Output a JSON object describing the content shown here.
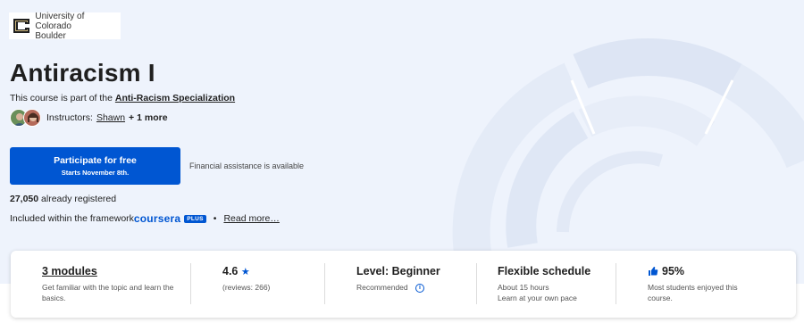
{
  "university": {
    "name_line1": "University of Colorado",
    "name_line2": "Boulder"
  },
  "course": {
    "title": "Antiracism I",
    "part_of_prefix": "This course is part of the",
    "specialization": "Anti-Racism Specialization"
  },
  "instructors": {
    "label": "Instructors:",
    "name": "Shawn",
    "more": "+ 1 more"
  },
  "cta": {
    "main": "Participate for free",
    "sub": "Starts November 8th."
  },
  "financial_aid": "Financial assistance is available",
  "registered": {
    "count": "27,050",
    "suffix": "already registered"
  },
  "included": {
    "prefix": "Included within the framework",
    "brand": "coursera",
    "plus": "PLUS",
    "bullet": "•",
    "read_more": "Read more…"
  },
  "info": {
    "modules": {
      "title": "3 modules",
      "sub": "Get familiar with the topic and learn the basics."
    },
    "rating": {
      "value": "4.6",
      "star": "★",
      "reviews": "(reviews: 266)"
    },
    "level": {
      "title": "Level: Beginner",
      "sub": "Recommended",
      "icon": "i"
    },
    "schedule": {
      "title": "Flexible schedule",
      "sub1": "About 15 hours",
      "sub2": "Learn at your own pace"
    },
    "satisfaction": {
      "value": "95%",
      "sub": "Most students enjoyed this course."
    }
  },
  "colors": {
    "accent": "#0056d2",
    "hero_bg": "#eef3fc"
  }
}
